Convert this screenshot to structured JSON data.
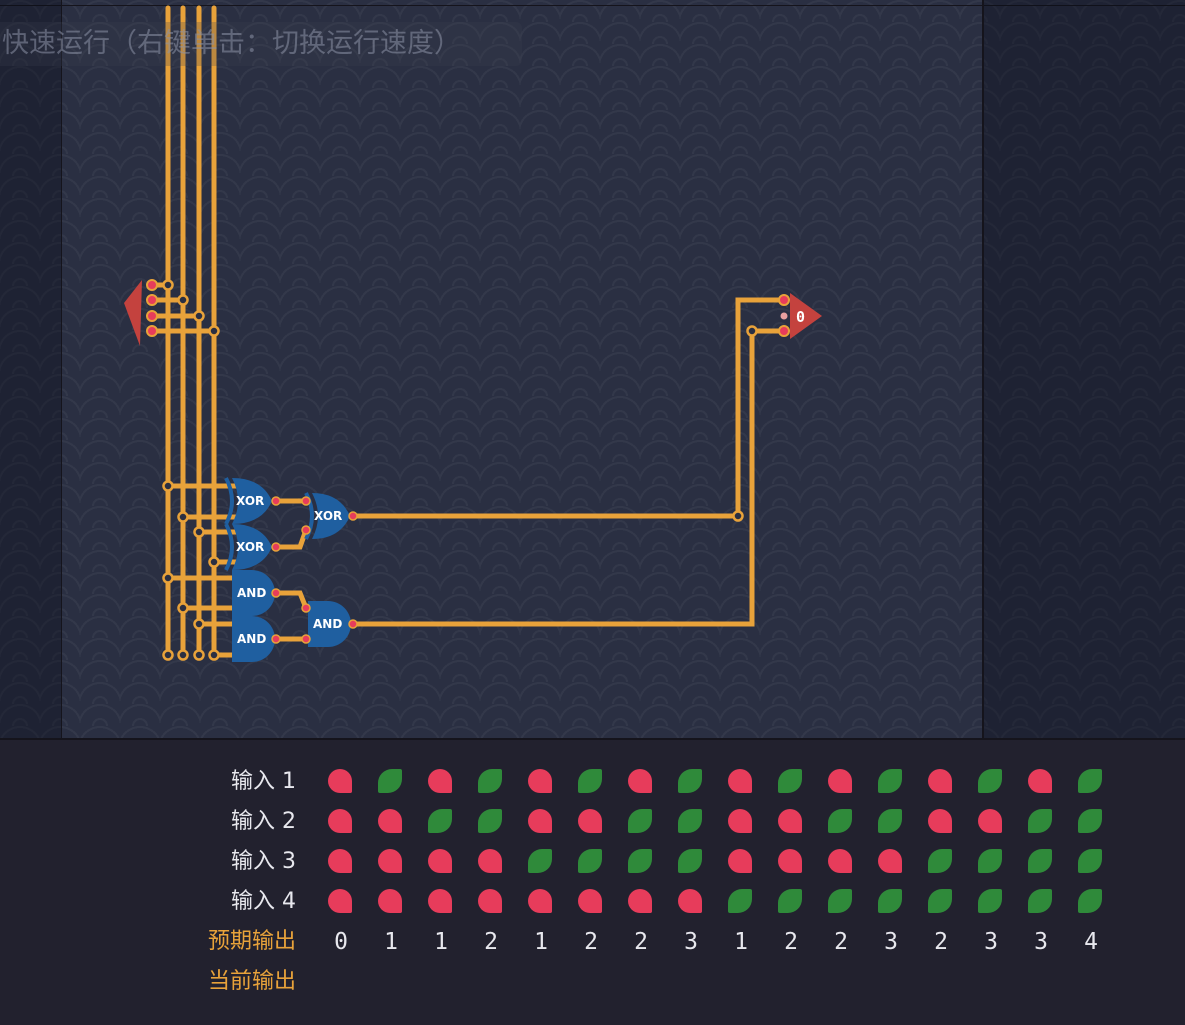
{
  "tooltip": "快速运行（右键单击：切换运行速度）",
  "colors": {
    "wire": "#e8a23a",
    "gate": "#1f5fa0",
    "input_pin": "#d04a4a",
    "on": "#2f8a3a",
    "off": "#e73c5b"
  },
  "circuit": {
    "gates": [
      {
        "name": "xor-gate-1",
        "label": "XOR"
      },
      {
        "name": "xor-gate-2",
        "label": "XOR"
      },
      {
        "name": "xor-gate-3",
        "label": "XOR"
      },
      {
        "name": "and-gate-1",
        "label": "AND"
      },
      {
        "name": "and-gate-2",
        "label": "AND"
      },
      {
        "name": "and-gate-3",
        "label": "AND"
      }
    ],
    "output_display": "0"
  },
  "truth_table": {
    "rows": [
      {
        "label": "输入 1",
        "values": [
          0,
          1,
          0,
          1,
          0,
          1,
          0,
          1,
          0,
          1,
          0,
          1,
          0,
          1,
          0,
          1
        ]
      },
      {
        "label": "输入 2",
        "values": [
          0,
          0,
          1,
          1,
          0,
          0,
          1,
          1,
          0,
          0,
          1,
          1,
          0,
          0,
          1,
          1
        ]
      },
      {
        "label": "输入 3",
        "values": [
          0,
          0,
          0,
          0,
          1,
          1,
          1,
          1,
          0,
          0,
          0,
          0,
          1,
          1,
          1,
          1
        ]
      },
      {
        "label": "输入 4",
        "values": [
          0,
          0,
          0,
          0,
          0,
          0,
          0,
          0,
          1,
          1,
          1,
          1,
          1,
          1,
          1,
          1
        ]
      }
    ],
    "expected_label": "预期输出",
    "expected": [
      "0",
      "1",
      "1",
      "2",
      "1",
      "2",
      "2",
      "3",
      "1",
      "2",
      "2",
      "3",
      "2",
      "3",
      "3",
      "4"
    ],
    "current_label": "当前输出",
    "current": []
  }
}
